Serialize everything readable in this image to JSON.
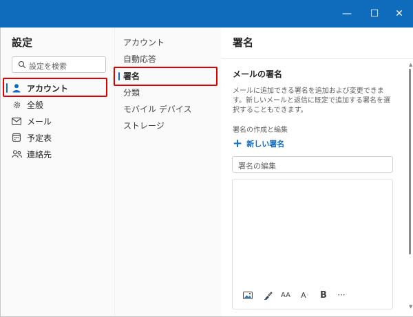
{
  "window": {
    "controls": {
      "minimize": "—",
      "maximize": "☐",
      "close": "✕"
    }
  },
  "left": {
    "title": "設定",
    "search_placeholder": "設定を検索",
    "items": [
      {
        "label": "アカウント",
        "icon": "person-icon",
        "active": true
      },
      {
        "label": "全般",
        "icon": "gear-icon",
        "active": false
      },
      {
        "label": "メール",
        "icon": "mail-icon",
        "active": false
      },
      {
        "label": "予定表",
        "icon": "calendar-icon",
        "active": false
      },
      {
        "label": "連絡先",
        "icon": "people-icon",
        "active": false
      }
    ]
  },
  "middle": {
    "items": [
      {
        "label": "アカウント",
        "active": false
      },
      {
        "label": "自動応答",
        "active": false
      },
      {
        "label": "署名",
        "active": true
      },
      {
        "label": "分類",
        "active": false
      },
      {
        "label": "モバイル デバイス",
        "active": false
      },
      {
        "label": "ストレージ",
        "active": false
      }
    ]
  },
  "right": {
    "title": "署名",
    "section_title": "メールの署名",
    "description": "メールに追加できる署名を追加および変更できます。新しいメールと返信に既定で追加する署名を選択することもできます。",
    "sub_label": "署名の作成と編集",
    "new_signature": "新しい署名",
    "new_signature_icon": "+",
    "name_placeholder": "署名の編集",
    "toolbar": {
      "image": "image-icon",
      "format_painter": "format-painter-icon",
      "font_size_label": "AA",
      "font_grow_label": "A",
      "bold_label": "B",
      "more_label": "···"
    }
  },
  "colors": {
    "accent": "#0f6cbd",
    "titlebar": "#0f6cbd",
    "highlight": "#e00000"
  }
}
